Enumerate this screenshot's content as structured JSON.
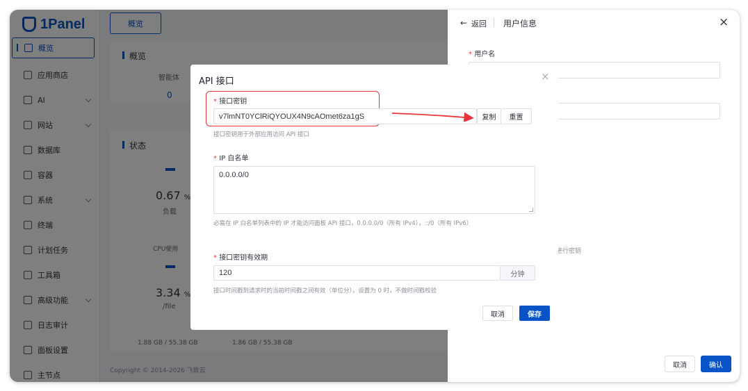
{
  "app": {
    "logo_text": "1Panel",
    "colors": {
      "accent": "#0854c7",
      "highlight": "#e8343a",
      "overlay": "rgba(0,0,0,0.5)"
    }
  },
  "sidebar": {
    "items": [
      {
        "label": "概览",
        "icon": "home-icon",
        "active": true,
        "has_arrow": false
      },
      {
        "label": "应用商店",
        "icon": "grid-icon",
        "has_arrow": false
      },
      {
        "label": "AI",
        "icon": "robot-icon",
        "has_arrow": true
      },
      {
        "label": "网站",
        "icon": "globe-icon",
        "has_arrow": true
      },
      {
        "label": "数据库",
        "icon": "database-icon",
        "has_arrow": false
      },
      {
        "label": "容器",
        "icon": "whale-icon",
        "has_arrow": false
      },
      {
        "label": "系统",
        "icon": "system-icon",
        "has_arrow": true
      },
      {
        "label": "终端",
        "icon": "terminal-icon",
        "has_arrow": false
      },
      {
        "label": "计划任务",
        "icon": "calendar-icon",
        "has_arrow": false
      },
      {
        "label": "工具箱",
        "icon": "toolbox-icon",
        "has_arrow": false
      },
      {
        "label": "高级功能",
        "icon": "diamond-icon",
        "has_arrow": true
      },
      {
        "label": "日志审计",
        "icon": "log-icon",
        "has_arrow": false
      },
      {
        "label": "面板设置",
        "icon": "settings-icon",
        "has_arrow": false
      },
      {
        "label": "主节点",
        "icon": "node-icon",
        "has_arrow": false
      }
    ]
  },
  "main": {
    "tab_label": "概览",
    "overview_title": "概览",
    "agent_label": "智能体",
    "agent_count": "0",
    "status_title": "状态",
    "cpu_value": "0.67",
    "cpu_unit": "%",
    "cpu_label": "负载",
    "cpu_sub": "CPU使用",
    "mem_value": "3.34",
    "mem_unit": "%",
    "mem_label": "/file",
    "disk_info_1": "1.88 GB / 55.38 GB",
    "disk_info_2": "1.86 GB / 55.38 GB",
    "copyright": "Copyright © 2014-2026 飞致云"
  },
  "drawer": {
    "back_label": "返回",
    "title": "用户信息",
    "username_label": "用户名",
    "hint_fragment": "进行密钥",
    "cancel": "取消",
    "confirm": "确认"
  },
  "modal": {
    "title": "API 接口",
    "api_key": {
      "label": "接口密钥",
      "value": "v7lmNT0YClRiQYOUX4N9cAOmet6za1gS",
      "hint": "接口密钥用于外部应用访问 API 接口",
      "copy": "复制",
      "reset": "重置"
    },
    "whitelist": {
      "label": "IP 白名单",
      "value": "0.0.0.0/0",
      "hint": "必需在 IP 白名单列表中的 IP 才能访问面板 API 接口，0.0.0.0/0（所有 IPv4），::/0（所有 IPv6）"
    },
    "validity": {
      "label": "接口密钥有效期",
      "value": "120",
      "unit": "分钟",
      "hint": "接口时间戳到请求时的当前时间戳之间有效（单位分），设置为 0 时，不做时间戳校验"
    },
    "cancel": "取消",
    "save": "保存"
  }
}
